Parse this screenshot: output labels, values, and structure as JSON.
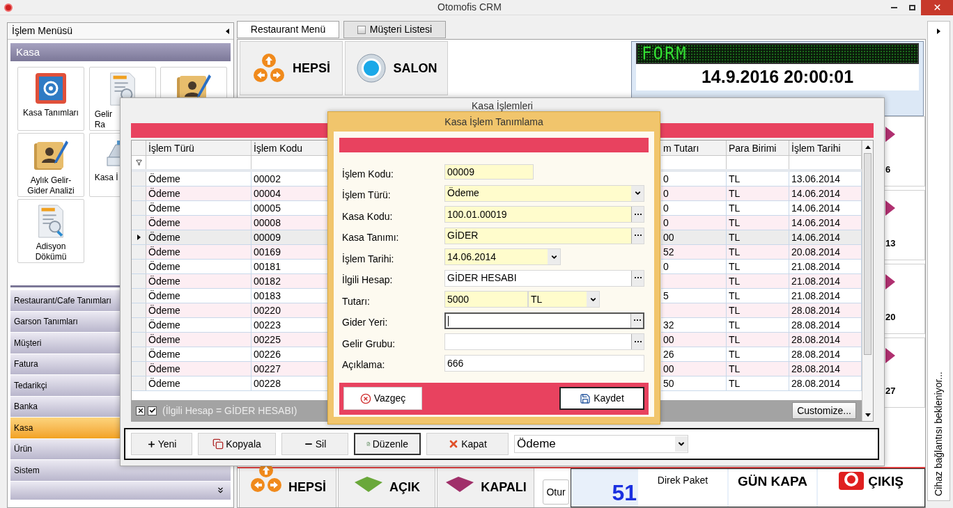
{
  "window": {
    "title": "Otomofis CRM"
  },
  "sidebar": {
    "title": "İşlem Menüsü",
    "group": "Kasa",
    "tiles": [
      {
        "kind": "safe",
        "lines": [
          "Kasa Tanımları"
        ]
      },
      {
        "kind": "report",
        "lines": [
          "Gelir",
          "Ra"
        ]
      },
      {
        "kind": "contacts"
      },
      {
        "kind": "contacts",
        "lines": [
          "Aylık Gelir-",
          "Gider Analizi"
        ]
      },
      {
        "kind": "calculator",
        "lines": [
          "Kasa İ"
        ]
      },
      {
        "kind": "report",
        "lines": [
          "Adisyon",
          "Dökümü"
        ]
      }
    ],
    "items": [
      {
        "label": "Restaurant/Cafe Tanımları",
        "selected": false
      },
      {
        "label": "Garson Tanımları",
        "selected": false
      },
      {
        "label": "Müşteri",
        "selected": false
      },
      {
        "label": "Fatura",
        "selected": false
      },
      {
        "label": "Tedarikçi",
        "selected": false
      },
      {
        "label": "Banka",
        "selected": false
      },
      {
        "label": "Kasa",
        "selected": true
      },
      {
        "label": "Ürün",
        "selected": false
      },
      {
        "label": "Sistem",
        "selected": false
      }
    ]
  },
  "tabs": [
    {
      "label": "Restaurant Menü",
      "selected": true
    },
    {
      "label": "Müşteri Listesi",
      "selected": false
    }
  ],
  "menu_tiles": [
    {
      "label": "HEPSİ",
      "kind": "arrows"
    },
    {
      "label": "SALON",
      "kind": "ring"
    }
  ],
  "clock": {
    "marquee": "FORM",
    "datetime": "14.9.2016 20:00:01"
  },
  "side_tiles": [
    "6",
    "13",
    "20",
    "27"
  ],
  "bottom_tiles": [
    {
      "label": "HEPSİ",
      "kind": "arrows"
    },
    {
      "label": "AÇIK",
      "kind": "green"
    },
    {
      "label": "KAPALI",
      "kind": "purple"
    }
  ],
  "session_button": "Otur",
  "count": "51",
  "direct_package": "Direk Paket",
  "day_close": "GÜN KAPA",
  "exit": "ÇIKIŞ",
  "status": "Cihaz bağlantısı bekleniyor...",
  "list_window": {
    "title": "Kasa İşlemleri",
    "columns": [
      "İşlem Türü",
      "İşlem Kodu",
      "m Tutarı",
      "Para Birimi",
      "İşlem Tarihi"
    ],
    "rows": [
      {
        "type": "Ödeme",
        "code": "00002",
        "amount": "0",
        "currency": "TL",
        "date": "13.06.2014",
        "selected": false
      },
      {
        "type": "Ödeme",
        "code": "00004",
        "amount": "0",
        "currency": "TL",
        "date": "14.06.2014",
        "selected": false
      },
      {
        "type": "Ödeme",
        "code": "00005",
        "amount": "0",
        "currency": "TL",
        "date": "14.06.2014",
        "selected": false
      },
      {
        "type": "Ödeme",
        "code": "00008",
        "amount": "0",
        "currency": "TL",
        "date": "14.06.2014",
        "selected": false
      },
      {
        "type": "Ödeme",
        "code": "00009",
        "amount": "00",
        "currency": "TL",
        "date": "14.06.2014",
        "selected": true
      },
      {
        "type": "Ödeme",
        "code": "00169",
        "amount": "52",
        "currency": "TL",
        "date": "20.08.2014",
        "selected": false
      },
      {
        "type": "Ödeme",
        "code": "00181",
        "amount": "0",
        "currency": "TL",
        "date": "21.08.2014",
        "selected": false
      },
      {
        "type": "Ödeme",
        "code": "00182",
        "currency": "TL",
        "date": "21.08.2014",
        "selected": false
      },
      {
        "type": "Ödeme",
        "code": "00183",
        "amount": "5",
        "currency": "TL",
        "date": "21.08.2014",
        "selected": false
      },
      {
        "type": "Ödeme",
        "code": "00220",
        "currency": "TL",
        "date": "28.08.2014",
        "selected": false
      },
      {
        "type": "Ödeme",
        "code": "00223",
        "amount": "32",
        "currency": "TL",
        "date": "28.08.2014",
        "selected": false
      },
      {
        "type": "Ödeme",
        "code": "00225",
        "amount": "00",
        "currency": "TL",
        "date": "28.08.2014",
        "selected": false
      },
      {
        "type": "Ödeme",
        "code": "00226",
        "amount": "26",
        "currency": "TL",
        "date": "28.08.2014",
        "selected": false
      },
      {
        "type": "Ödeme",
        "code": "00227",
        "amount": "00",
        "currency": "TL",
        "date": "28.08.2014",
        "selected": false
      },
      {
        "type": "Ödeme",
        "code": "00228",
        "amount": "50",
        "currency": "TL",
        "date": "28.08.2014",
        "selected": false
      }
    ],
    "filter": {
      "checked": true,
      "text": "(İlgili Hesap = GİDER HESABI)"
    },
    "customize": "Customize...",
    "toolbar": [
      {
        "label": "Yeni",
        "kind": "plus",
        "focused": false
      },
      {
        "label": "Kopyala",
        "kind": "copy",
        "focused": false
      },
      {
        "label": "Sil",
        "kind": "minus",
        "focused": false
      },
      {
        "label": "Düzenle",
        "kind": "edit",
        "focused": true
      },
      {
        "label": "Kapat",
        "kind": "close",
        "focused": false
      }
    ],
    "type_combo": "Ödeme"
  },
  "dialog": {
    "title": "Kasa İşlem Tanımlama",
    "fields": [
      {
        "label": "İşlem Kodu:",
        "kind": "short",
        "value": "00009",
        "required": true,
        "focused": false
      },
      {
        "label": "İşlem Türü:",
        "kind": "combo",
        "value": "Ödeme",
        "required": true,
        "focused": false
      },
      {
        "label": "Kasa Kodu:",
        "kind": "lookup",
        "value": "100.01.00019",
        "required": true,
        "focused": false
      },
      {
        "label": "Kasa Tanımı:",
        "kind": "lookup",
        "value": "GİDER",
        "required": true,
        "focused": false
      },
      {
        "label": "İşlem Tarihi:",
        "kind": "date",
        "value": "14.06.2014",
        "required": true,
        "focused": false
      },
      {
        "label": "İlgili Hesap:",
        "kind": "lookup",
        "value": "GİDER HESABI",
        "required": false,
        "focused": false
      },
      {
        "label": "Tutarı:",
        "kind": "amount",
        "value": "5000",
        "currency": "TL",
        "required": true,
        "focused": false
      },
      {
        "label": "Gider Yeri:",
        "kind": "lookup",
        "required": false,
        "focused": true
      },
      {
        "label": "Gelir Grubu:",
        "kind": "lookup",
        "required": false,
        "focused": false
      },
      {
        "label": "Açıklama:",
        "kind": "text",
        "value": "666",
        "required": false,
        "focused": false
      }
    ],
    "buttons": [
      {
        "label": "Vazgeç",
        "kind": "cancel",
        "default": false
      },
      {
        "label": "Kaydet",
        "kind": "save",
        "default": true
      }
    ]
  }
}
